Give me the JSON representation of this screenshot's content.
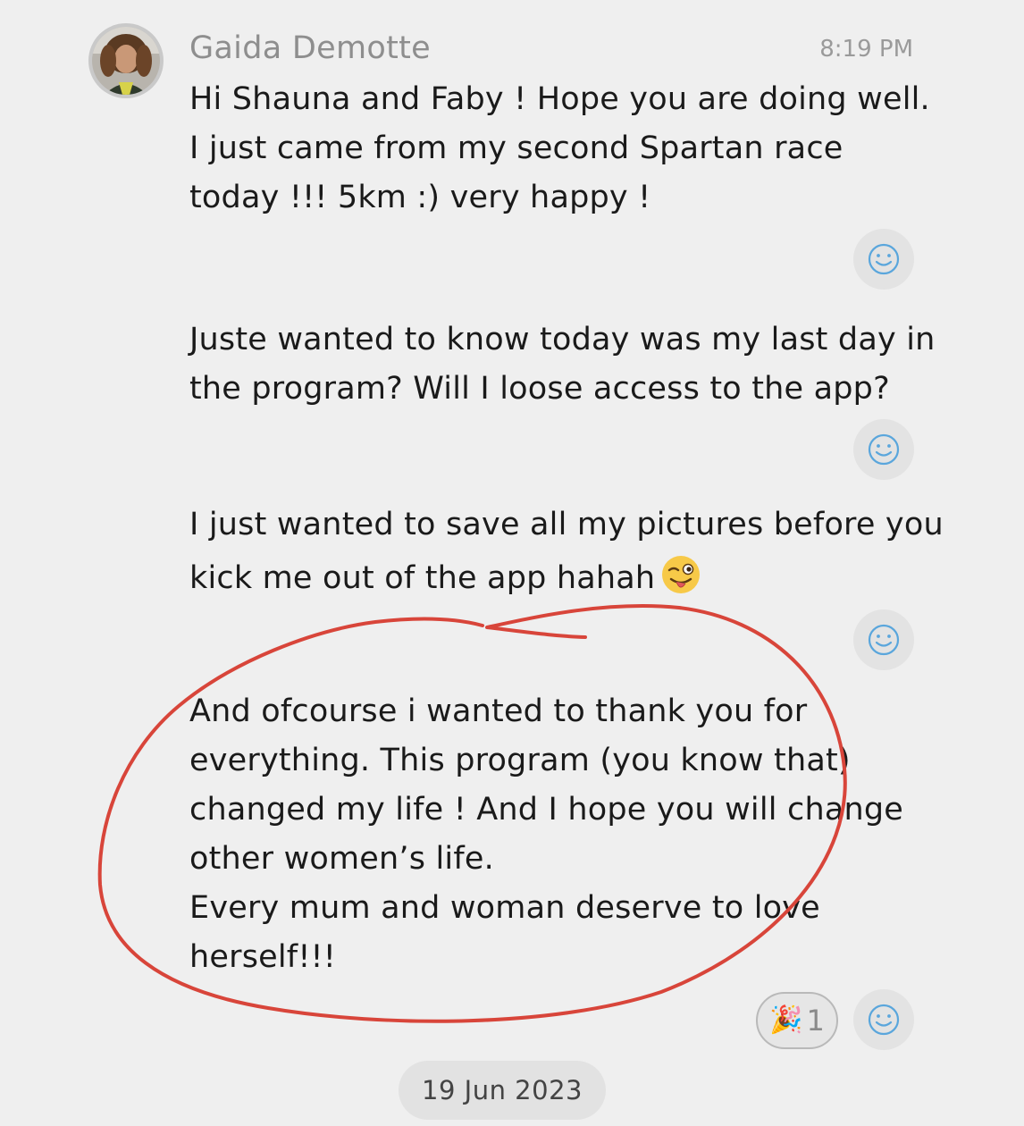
{
  "message": {
    "sender": "Gaida Demotte",
    "time": "8:19 PM",
    "avatar_icon": "user-avatar-photo"
  },
  "paragraphs": [
    {
      "lines": [
        "Hi Shauna and Faby ! Hope you are doing well.",
        "I just came from my second Spartan race",
        "today !!! 5km :) very happy !"
      ]
    },
    {
      "lines": [
        "Juste wanted to know today was my last day in",
        "the program? Will I loose access to the app?"
      ]
    },
    {
      "lines": [
        "I just wanted to save all my pictures before you",
        "kick me out of the app hahah"
      ],
      "trailing_emoji": "winking-face-with-tongue"
    },
    {
      "lines": [
        "And ofcourse i wanted to thank you for",
        "everything. This program (you know that)",
        "changed my life ! And I hope you will change",
        "other women’s life.",
        "Every mum and woman deserve to love",
        "herself!!!"
      ]
    }
  ],
  "reactions": {
    "emoji": "🎉",
    "count": "1",
    "add_reaction_icon": "smiley-icon"
  },
  "date_separator": "19 Jun 2023",
  "annotation_color": "#d8453a"
}
